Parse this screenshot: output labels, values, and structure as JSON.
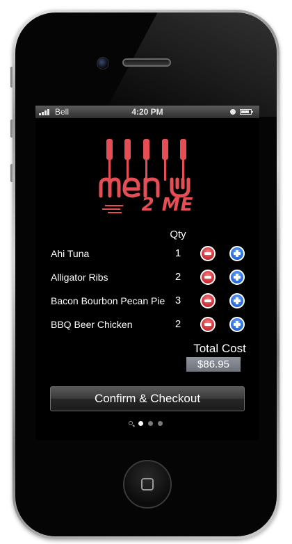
{
  "status_bar": {
    "carrier": "Bell",
    "time": "4:20 PM",
    "icons": [
      "signal-icon",
      "lock-icon",
      "battery-icon"
    ]
  },
  "logo": {
    "subtitle": "2 ME",
    "brand_color": "#e54e55"
  },
  "order": {
    "qty_header": "Qty",
    "items": [
      {
        "name": "Ahi Tuna",
        "qty": "1"
      },
      {
        "name": "Alligator Ribs",
        "qty": "2"
      },
      {
        "name": "Bacon Bourbon Pecan Pie",
        "qty": "3"
      },
      {
        "name": "BBQ Beer Chicken",
        "qty": "2"
      }
    ]
  },
  "total": {
    "label": "Total Cost",
    "value": "$86.95"
  },
  "checkout": {
    "label": "Confirm & Checkout"
  },
  "pager": {
    "pages": 3,
    "active_index": 0
  },
  "colors": {
    "minus": "#d3333b",
    "plus": "#2c6fe0",
    "background": "#000000"
  }
}
